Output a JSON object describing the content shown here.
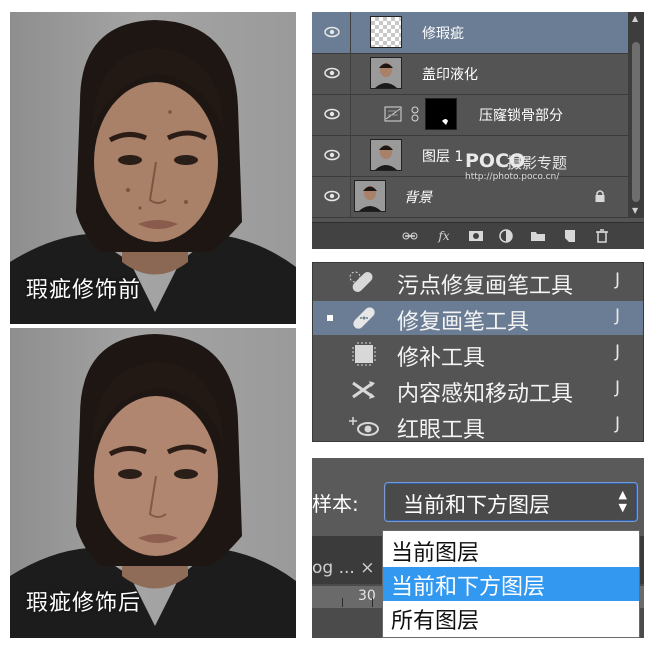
{
  "photos": {
    "before_caption": "瑕疵修饰前",
    "after_caption": "瑕疵修饰后"
  },
  "layers_panel": {
    "layers": [
      {
        "name": "修瑕疵",
        "thumb": "transparent",
        "selected": true
      },
      {
        "name": "盖印液化",
        "thumb": "photo",
        "selected": false
      },
      {
        "name": "压窿锁骨部分",
        "thumb": "adjustment-with-mask",
        "selected": false
      },
      {
        "name": "图层 1",
        "thumb": "photo",
        "selected": false
      },
      {
        "name": "背景",
        "thumb": "photo",
        "selected": false,
        "locked": true
      }
    ],
    "watermark": {
      "brand": "POCO",
      "title": "摄影专题",
      "url": "http://photo.poco.cn/"
    },
    "footer_icons": [
      "link-icon",
      "fx-icon",
      "mask-icon",
      "adjustment-icon",
      "folder-icon",
      "new-layer-icon",
      "trash-icon"
    ],
    "footer_fx": "fx"
  },
  "tools_menu": {
    "items": [
      {
        "label": "污点修复画笔工具",
        "key": "J",
        "icon": "spot-healing-brush-icon",
        "selected": false
      },
      {
        "label": "修复画笔工具",
        "key": "J",
        "icon": "healing-brush-icon",
        "selected": true
      },
      {
        "label": "修补工具",
        "key": "J",
        "icon": "patch-tool-icon",
        "selected": false
      },
      {
        "label": "内容感知移动工具",
        "key": "J",
        "icon": "content-aware-move-icon",
        "selected": false
      },
      {
        "label": "红眼工具",
        "key": "J",
        "icon": "red-eye-icon",
        "selected": false
      }
    ]
  },
  "sample_dropdown": {
    "label": "样本:",
    "selected_value": "当前和下方图层",
    "options": [
      {
        "label": "当前图层",
        "selected": false
      },
      {
        "label": "当前和下方图层",
        "selected": true
      },
      {
        "label": "所有图层",
        "selected": false
      }
    ],
    "tab_fragment": "og ... ×",
    "ruler_number": "30"
  },
  "colors": {
    "panel_bg": "#545454",
    "selection": "#6b7d94",
    "dropdown_highlight": "#3298f0"
  }
}
